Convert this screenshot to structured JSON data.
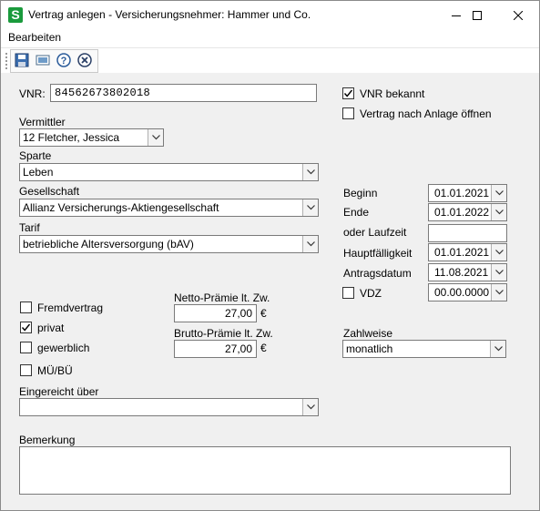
{
  "window": {
    "title": "Vertrag anlegen - Versicherungsnehmer:  Hammer und Co.",
    "logo_letter": "S"
  },
  "menu": {
    "items": [
      "Bearbeiten"
    ]
  },
  "toolbar": {
    "icons": [
      "save-icon",
      "screen-icon",
      "help-icon",
      "cancel-icon"
    ]
  },
  "form": {
    "vnr_label": "VNR:",
    "vnr_value": "84562673802018",
    "vnr_bekannt_label": "VNR bekannt",
    "vnr_bekannt_checked": true,
    "nach_anlage_label": "Vertrag nach Anlage öffnen",
    "nach_anlage_checked": false,
    "vermittler_label": "Vermittler",
    "vermittler_value": "12  Fletcher, Jessica",
    "sparte_label": "Sparte",
    "sparte_value": "Leben",
    "gesellschaft_label": "Gesellschaft",
    "gesellschaft_value": "Allianz Versicherungs-Aktiengesellschaft",
    "tarif_label": "Tarif",
    "tarif_value": "betriebliche Altersversorgung (bAV)",
    "beginn_label": "Beginn",
    "beginn_value": "01.01.2021",
    "ende_label": "Ende",
    "ende_value": "01.01.2022",
    "laufzeit_label": "oder Laufzeit",
    "laufzeit_value": "",
    "hauptfaelligkeit_label": "Hauptfälligkeit",
    "hauptfaelligkeit_value": "01.01.2021",
    "antragsdatum_label": "Antragsdatum",
    "antragsdatum_value": "11.08.2021",
    "vdz_label": "VDZ",
    "vdz_checked": false,
    "vdz_value": "00.00.0000",
    "fremdvertrag_label": "Fremdvertrag",
    "fremdvertrag_checked": false,
    "privat_label": "privat",
    "privat_checked": true,
    "gewerblich_label": "gewerblich",
    "gewerblich_checked": false,
    "mubu_label": "MÜ/BÜ",
    "mubu_checked": false,
    "netto_label": "Netto-Prämie lt. Zw.",
    "netto_value": "27,00",
    "brutto_label": "Brutto-Prämie lt. Zw.",
    "brutto_value": "27,00",
    "currency": "€",
    "zahlweise_label": "Zahlweise",
    "zahlweise_value": "monatlich",
    "eingereicht_label": "Eingereicht über",
    "eingereicht_value": "",
    "bemerkung_label": "Bemerkung",
    "bemerkung_value": ""
  }
}
